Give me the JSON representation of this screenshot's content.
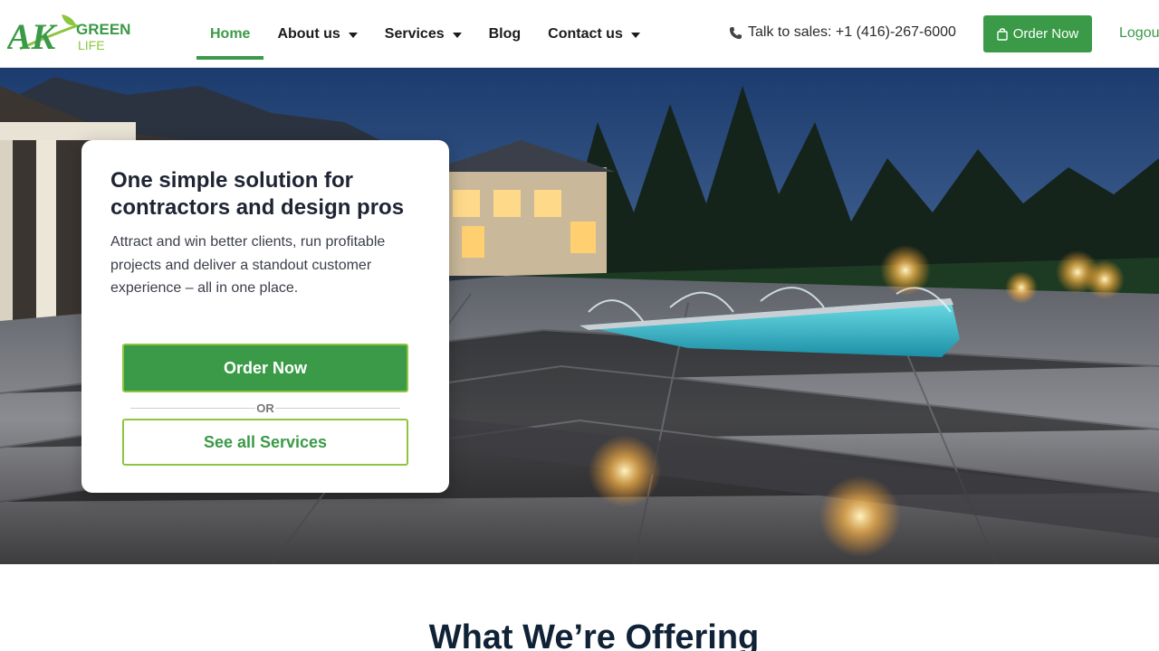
{
  "brand": {
    "logo_letters": "AK",
    "logo_word1": "GREEN",
    "logo_word2": "LIFE",
    "green": "#3a9a47",
    "lime": "#8cc63f"
  },
  "nav": {
    "items": [
      {
        "label": "Home",
        "active": true,
        "dropdown": false
      },
      {
        "label": "About us",
        "active": false,
        "dropdown": true
      },
      {
        "label": "Services",
        "active": false,
        "dropdown": true
      },
      {
        "label": "Blog",
        "active": false,
        "dropdown": false
      },
      {
        "label": "Contact us",
        "active": false,
        "dropdown": true
      }
    ]
  },
  "header": {
    "phone_text": "Talk to sales: +1 (416)-267-6000",
    "order_label": "Order Now",
    "logout_label": "Logout"
  },
  "hero": {
    "title": "One simple solution for contractors and design pros",
    "text": "Attract and win better clients, run profitable projects and deliver a standout customer experience – all in one place.",
    "order_label": "Order Now",
    "or_label": "OR",
    "services_label": "See all Services"
  },
  "offering": {
    "title": "What We’re Offering"
  },
  "icons": {
    "phone": "phone-icon",
    "bag": "shopping-bag-icon",
    "caret": "chevron-down-icon"
  }
}
